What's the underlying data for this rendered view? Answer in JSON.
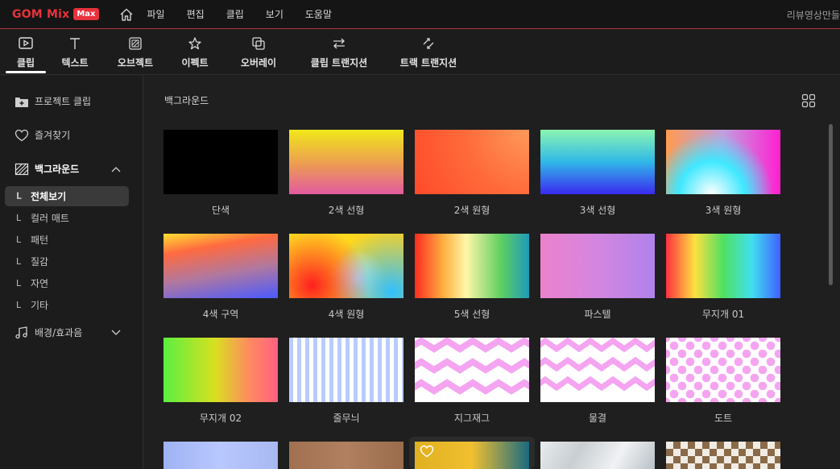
{
  "app": {
    "logo_text": "GOM Mix",
    "logo_badge": "Max",
    "project_name": "리뷰영상만들"
  },
  "menu": [
    "파일",
    "편집",
    "클립",
    "보기",
    "도움말"
  ],
  "toolbar": [
    {
      "label": "클립",
      "icon": "clip-icon",
      "active": true
    },
    {
      "label": "텍스트",
      "icon": "text-icon"
    },
    {
      "label": "오브젝트",
      "icon": "object-icon"
    },
    {
      "label": "이펙트",
      "icon": "effect-star-icon"
    },
    {
      "label": "오버레이",
      "icon": "overlay-icon"
    },
    {
      "label": "클립 트랜지션",
      "icon": "clip-transition-icon"
    },
    {
      "label": "트랙 트랜지션",
      "icon": "track-transition-icon"
    }
  ],
  "sidebar": {
    "project_clip": "프로젝트 클립",
    "favorites": "즐겨찾기",
    "background": "백그라운드",
    "background_sub": [
      "전체보기",
      "컬러 매트",
      "패턴",
      "질감",
      "자연",
      "기타"
    ],
    "bgm": "배경/효과음"
  },
  "main": {
    "title": "백그라운드",
    "items": [
      "단색",
      "2색 선형",
      "2색 원형",
      "3색 선형",
      "3색 원형",
      "4색 구역",
      "4색 원형",
      "5색 선형",
      "파스텔",
      "무지개 01",
      "무지개 02",
      "줄무늬",
      "지그재그",
      "물결",
      "도트"
    ]
  },
  "colors": {
    "accent": "#e8323d",
    "background": "#1f1f1f"
  }
}
